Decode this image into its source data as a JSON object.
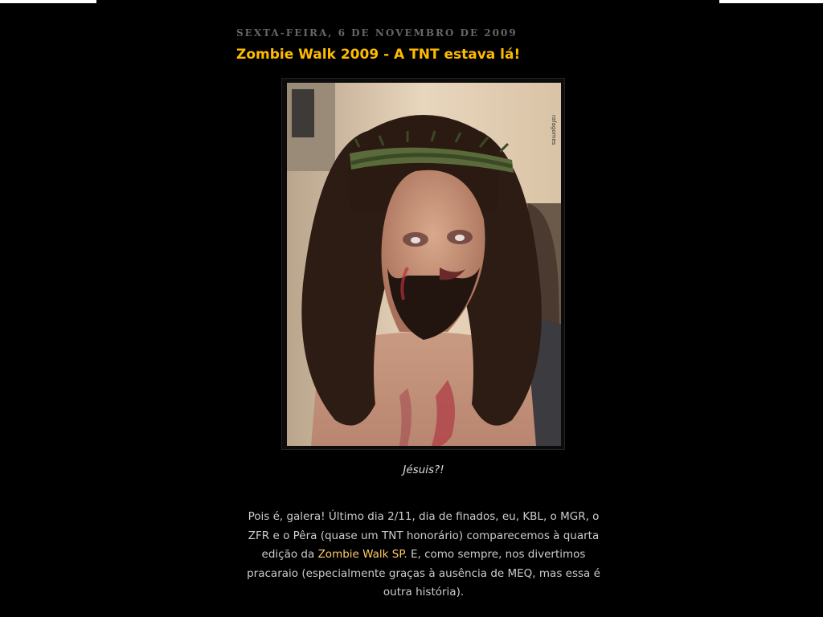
{
  "post": {
    "date_header": "SEXTA-FEIRA, 6 DE NOVEMBRO DE 2009",
    "title": "Zombie Walk 2009 - A TNT estava lá!",
    "image": {
      "description_icon": "photo-zombie-jesus",
      "watermark": "rafagomes"
    },
    "caption": "Jésuis?!",
    "body": {
      "text_before_link": "Pois é, galera! Último dia 2/11, dia de finados, eu, KBL, o MGR, o ZFR e o Pêra (quase um TNT honorário) comparecemos à quarta edição da ",
      "link_text": "Zombie Walk SP",
      "text_after_link": ". E, como sempre, nos divertimos pracaraio (especialmente graças à ausência de MEQ, mas essa é outra história)."
    }
  },
  "colors": {
    "background": "#000000",
    "title": "#ffbb00",
    "date": "#666666",
    "body_text": "#cccccc",
    "link": "#ffcc66"
  }
}
